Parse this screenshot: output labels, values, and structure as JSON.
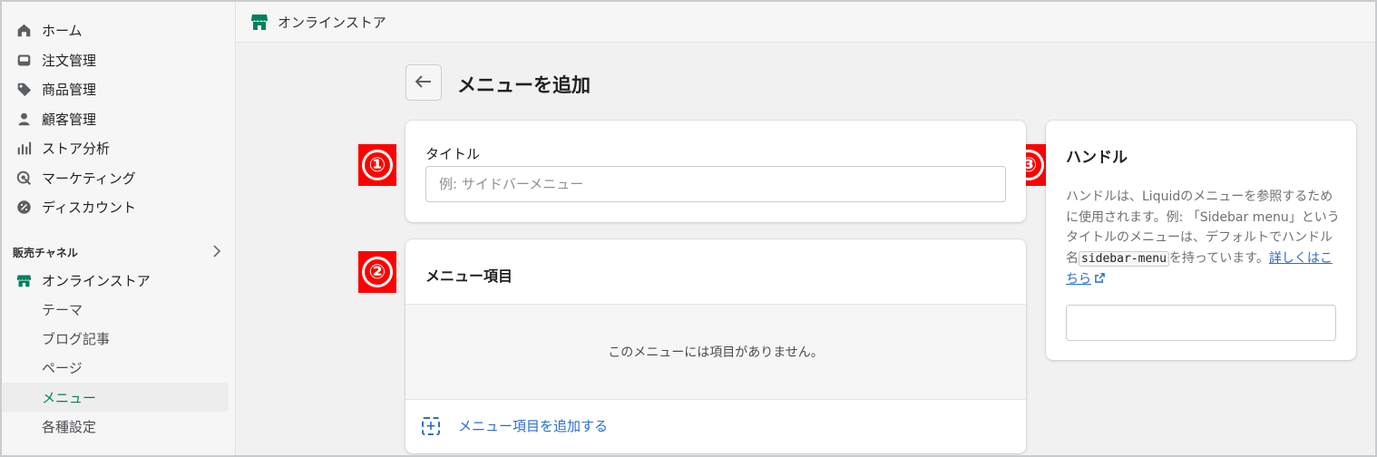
{
  "sidebar": {
    "items": [
      {
        "label": "ホーム",
        "icon": "home-icon"
      },
      {
        "label": "注文管理",
        "icon": "inbox-icon"
      },
      {
        "label": "商品管理",
        "icon": "tag-icon"
      },
      {
        "label": "顧客管理",
        "icon": "person-icon"
      },
      {
        "label": "ストア分析",
        "icon": "bar-chart-icon"
      },
      {
        "label": "マーケティング",
        "icon": "target-icon"
      },
      {
        "label": "ディスカウント",
        "icon": "discount-icon"
      }
    ],
    "section_label": "販売チャネル",
    "channel": {
      "label": "オンラインストア",
      "icon": "store-icon"
    },
    "sub_items": [
      {
        "label": "テーマ"
      },
      {
        "label": "ブログ記事"
      },
      {
        "label": "ページ"
      },
      {
        "label": "メニュー",
        "active": true
      },
      {
        "label": "各種設定"
      }
    ]
  },
  "topbar": {
    "title": "オンラインストア",
    "icon": "store-icon"
  },
  "header": {
    "title": "メニューを追加",
    "back_icon": "arrow-left-icon"
  },
  "title_card": {
    "label": "タイトル",
    "placeholder": "例: サイドバーメニュー",
    "value": ""
  },
  "menu_card": {
    "title": "メニュー項目",
    "empty_text": "このメニューには項目がありません。",
    "add_label": "メニュー項目を追加する"
  },
  "handle_card": {
    "title": "ハンドル",
    "desc_1": "ハンドルは、Liquidのメニューを参照するために使用されます。例: 「Sidebar menu」というタイトルのメニューは、デフォルトでハンドル名",
    "code": "sidebar-menu",
    "desc_2": "を持っています。",
    "link": "詳しくはこちら",
    "value": ""
  },
  "annotations": [
    "①",
    "②",
    "③"
  ],
  "colors": {
    "accent_green": "#008060",
    "link_blue": "#2c6ecb",
    "annotation_red": "#ff0000"
  }
}
